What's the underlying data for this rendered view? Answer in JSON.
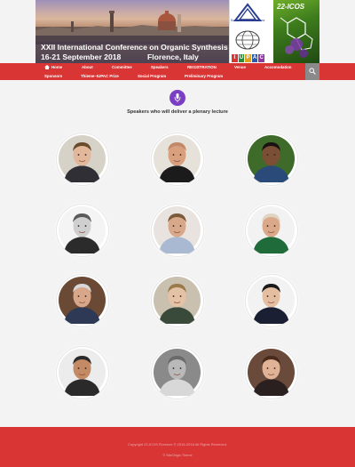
{
  "banner": {
    "title": "XXII International Conference on Organic Synthesis",
    "dates": "16-21 September 2018",
    "place": "Florence, Italy",
    "society": "Società Chimica Italiana",
    "iupac": [
      "I",
      "U",
      "P",
      "A",
      "C"
    ],
    "icos": "22-ICOS"
  },
  "nav": {
    "row1": [
      "Home",
      "About",
      "Committee",
      "Speakers",
      "REGISTRATION",
      "Venue",
      "Accomodation"
    ],
    "row2": [
      "Sponsors",
      "Thieme–IUPAC Prize",
      "Social Program",
      "Preliminary Program"
    ]
  },
  "main": {
    "heading": "Speakers who will deliver a plenary lecture"
  },
  "speakers": [
    {
      "name": "speaker-1",
      "skin": "#e3b89a",
      "hair": "#6b4a2a",
      "shirt": "#2f2f35",
      "bg": "#d7d2c8"
    },
    {
      "name": "speaker-2",
      "skin": "#d9a07e",
      "hair": "#c08a6a",
      "shirt": "#1b1b1b",
      "bg": "#e6e1d9"
    },
    {
      "name": "speaker-3",
      "skin": "#7a4f36",
      "hair": "#1a1210",
      "shirt": "#2a4a7a",
      "bg": "#3f6b2a"
    },
    {
      "name": "speaker-4",
      "skin": "#cfcfcf",
      "hair": "#5a5a5a",
      "shirt": "#2b2b2b",
      "bg": "#f4f4f4"
    },
    {
      "name": "speaker-5",
      "skin": "#d8a88a",
      "hair": "#7a5a3a",
      "shirt": "#a9b9d1",
      "bg": "#e8e3de"
    },
    {
      "name": "speaker-6",
      "skin": "#d9a98a",
      "hair": "#e0d5c5",
      "shirt": "#1f6b3a",
      "bg": "#f2f2f2"
    },
    {
      "name": "speaker-7",
      "skin": "#d8a78a",
      "hair": "#d8d8d8",
      "shirt": "#2e3a55",
      "bg": "#6b4a35"
    },
    {
      "name": "speaker-8",
      "skin": "#e4c2a6",
      "hair": "#9a7a4a",
      "shirt": "#3a4a3a",
      "bg": "#c9c0b0"
    },
    {
      "name": "speaker-9",
      "skin": "#e3bea0",
      "hair": "#1a1a1a",
      "shirt": "#1a1f33",
      "bg": "#f2f2f2"
    },
    {
      "name": "speaker-10",
      "skin": "#c48a64",
      "hair": "#2a2a2a",
      "shirt": "#2a2a2a",
      "bg": "#ececec"
    },
    {
      "name": "speaker-11",
      "skin": "#b9b9b9",
      "hair": "#6a6a6a",
      "shirt": "#d8d8d8",
      "bg": "#8a8a8a"
    },
    {
      "name": "speaker-12",
      "skin": "#e0b396",
      "hair": "#4a2a1a",
      "shirt": "#2a2020",
      "bg": "#6a4a3a"
    }
  ],
  "footer": {
    "copyright": "Copyright 22-ICOS Florence © 2016-2018 All Rights Reserved.",
    "credit": "© SiteOrigin Theme"
  },
  "colors": {
    "brand_red": "#d93535",
    "accent_purple": "#7b3fc4"
  }
}
